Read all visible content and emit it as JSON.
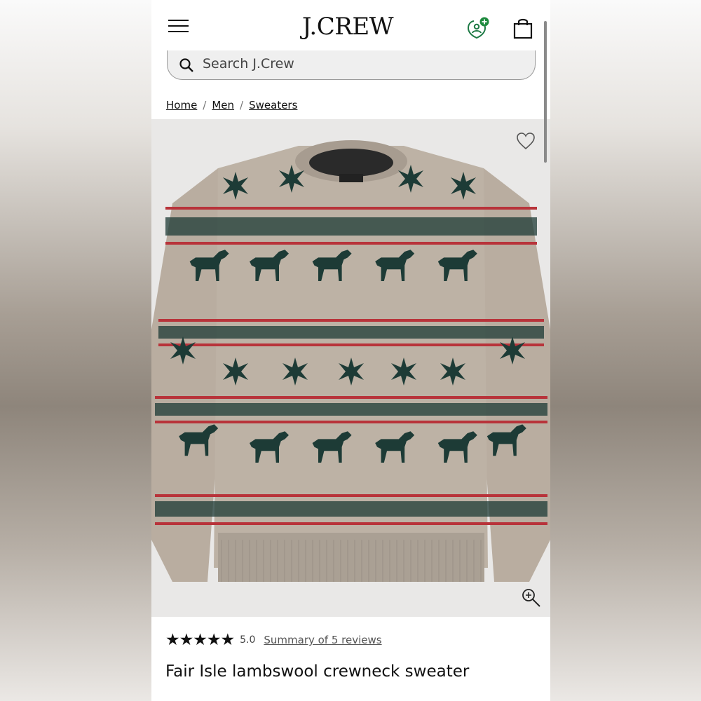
{
  "header": {
    "logo": "J.CREW",
    "menu_icon": "hamburger-menu-icon",
    "account_icon": "account-icon",
    "bag_icon": "shopping-bag-icon"
  },
  "search": {
    "placeholder": "Search J.Crew",
    "icon": "search-icon"
  },
  "breadcrumb": {
    "items": [
      "Home",
      "Men",
      "Sweaters"
    ],
    "separator": "/"
  },
  "product": {
    "image_description": "Fair Isle lambswool crewneck sweater with dogs and snowflakes",
    "rating_stars": "★★★★★",
    "rating_value": "5.0",
    "reviews_link": "Summary of 5 reviews",
    "title": "Fair Isle lambswool crewneck sweater",
    "favorite_icon": "heart-icon",
    "zoom_icon": "zoom-in-icon"
  },
  "colors": {
    "sweater_base": "#b9ada0",
    "pattern_green": "#1d3b36",
    "pattern_red": "#b8333a",
    "account_badge": "#1e8a3e"
  }
}
